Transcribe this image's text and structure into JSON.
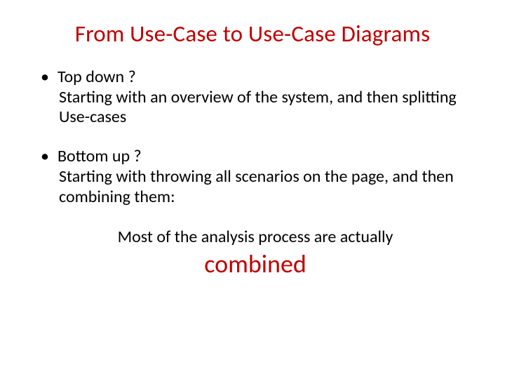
{
  "title": "From Use-Case to Use-Case Diagrams",
  "items": [
    {
      "heading": "Top down ?",
      "body": "Starting with an overview of the system, and then splitting Use-cases"
    },
    {
      "heading": "Bottom up ?",
      "body": "Starting with throwing all scenarios on the page, and then combining them:"
    }
  ],
  "footer": "Most of the analysis process are actually",
  "emphasis": "combined"
}
